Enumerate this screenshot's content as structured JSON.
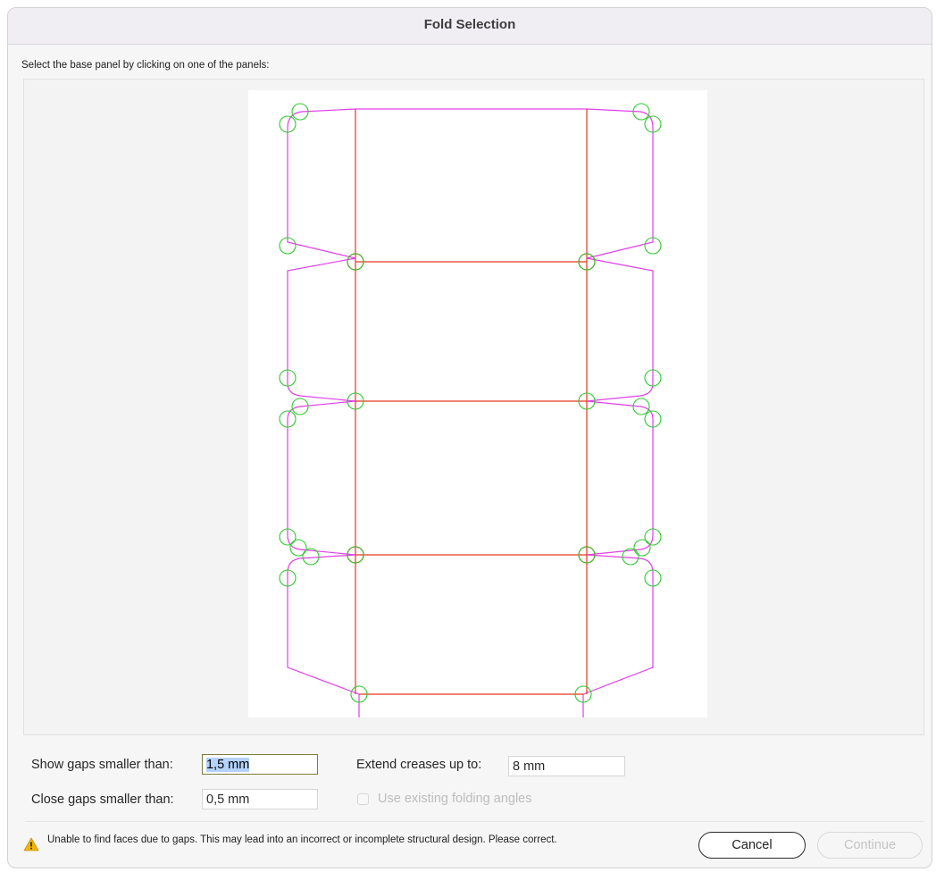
{
  "window": {
    "title": "Fold Selection"
  },
  "instruction": "Select the base panel by clicking on one of the panels:",
  "options": {
    "show_gaps_label": "Show gaps smaller than:",
    "show_gaps_value": "1,5 mm",
    "close_gaps_label": "Close gaps smaller than:",
    "close_gaps_value": "0,5 mm",
    "extend_creases_label": "Extend creases up to:",
    "extend_creases_value": "8 mm",
    "use_angles_label": "Use existing folding angles",
    "use_angles_checked": false,
    "use_angles_enabled": false
  },
  "warning": {
    "icon": "warning-triangle-icon",
    "text": "Unable to find faces due to gaps.  This may lead into an incorrect or incomplete structural design.  Please correct."
  },
  "buttons": {
    "cancel": "Cancel",
    "continue": "Continue"
  },
  "colors": {
    "cut_line": "#e040e8",
    "crease_line": "#e8361c",
    "gap_marker": "#2ec82e",
    "warning": "#f2b705"
  }
}
